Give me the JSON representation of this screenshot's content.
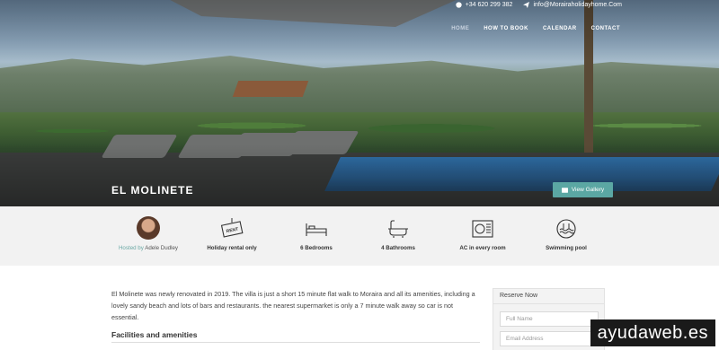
{
  "topbar": {
    "phone": "+34 620 299 382",
    "email": "info@Morairaholidayhome.Com"
  },
  "nav": {
    "items": [
      {
        "label": "HOME",
        "active": true
      },
      {
        "label": "HOW TO BOOK",
        "active": false
      },
      {
        "label": "CALENDAR",
        "active": false
      },
      {
        "label": "CONTACT",
        "active": false
      }
    ]
  },
  "hero": {
    "title": "EL MOLINETE",
    "gallery_button": "View Gallery"
  },
  "features": {
    "host": {
      "prefix": "Hosted by",
      "name": "Adele Dudley"
    },
    "items": [
      {
        "label": "Holiday rental only",
        "icon": "rent-sign-icon"
      },
      {
        "label": "6 Bedrooms",
        "icon": "bed-icon"
      },
      {
        "label": "4 Bathrooms",
        "icon": "bathtub-icon"
      },
      {
        "label": "AC in every room",
        "icon": "air-conditioner-icon"
      },
      {
        "label": "Swimming pool",
        "icon": "pool-icon"
      }
    ],
    "rent_sign_text": "RENT"
  },
  "content": {
    "description": "El Molinete was newly renovated in 2019. The villa is just a short 15 minute flat walk to Moraira and all its amenities, including a lovely sandy beach and lots of bars and restaurants. the nearest supermarket is only a 7 minute walk away so car is not essential.",
    "facilities_heading": "Facilities and amenities"
  },
  "reserve": {
    "title": "Reserve Now",
    "name_placeholder": "Full Name",
    "email_placeholder": "Email Address"
  },
  "watermark": "ayudaweb.es",
  "colors": {
    "accent": "#5ba7a3",
    "features_bg": "#f2f2f2"
  }
}
